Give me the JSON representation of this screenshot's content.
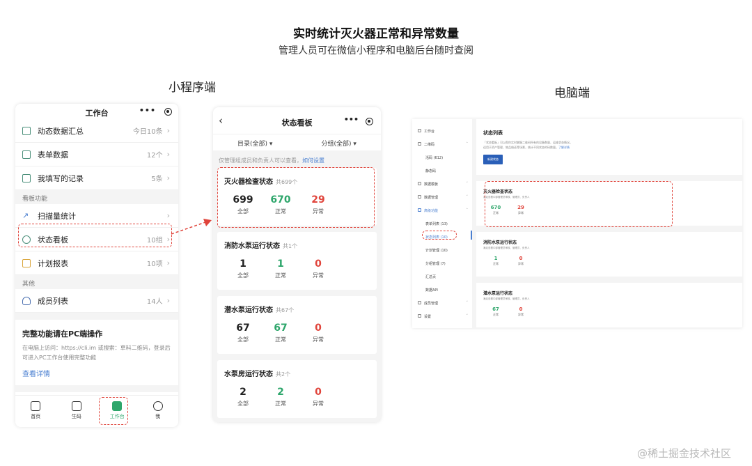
{
  "header": {
    "title": "实时统计灭火器正常和异常数量",
    "subtitle": "管理人员可在微信小程序和电脑后台随时查阅"
  },
  "labels": {
    "mini": "小程序端",
    "pc": "电脑端"
  },
  "watermark": "@稀土掘金技术社区",
  "phone1": {
    "title": "工作台",
    "menu_dots": "•••",
    "rows_top": [
      {
        "label": "动态数据汇总",
        "value": "今日10条",
        "icon": "chart-icon"
      },
      {
        "label": "表单数据",
        "value": "12个",
        "icon": "form-icon"
      },
      {
        "label": "我填写的记录",
        "value": "5条",
        "icon": "record-icon"
      }
    ],
    "section_board": "看板功能",
    "rows_board": [
      {
        "label": "扫描量统计",
        "value": "",
        "icon": "trend-icon"
      },
      {
        "label": "状态看板",
        "value": "10组",
        "icon": "status-icon"
      },
      {
        "label": "计划报表",
        "value": "10项",
        "icon": "plan-icon"
      }
    ],
    "section_other": "其他",
    "rows_other": [
      {
        "label": "成员列表",
        "value": "14人",
        "icon": "member-icon"
      }
    ],
    "promo": {
      "title": "完整功能请在PC端操作",
      "text": "在电脑上访问：https://cli.im 或搜索：草料二维码，登录后可进入PC工作台使用完整功能",
      "link": "查看详情"
    },
    "tabs": [
      {
        "label": "首页",
        "icon": "home-icon"
      },
      {
        "label": "生码",
        "icon": "grid-icon"
      },
      {
        "label": "工作台",
        "icon": "cube-icon"
      },
      {
        "label": "我",
        "icon": "user-icon"
      }
    ],
    "chevron": "›"
  },
  "phone2": {
    "back": "‹",
    "title": "状态看板",
    "menu_dots": "•••",
    "filter_dir": "目录(全部) ▾",
    "filter_group": "分组(全部) ▾",
    "notice": "仅管理组成员和负责人可以查看，",
    "notice_link": "如何设置",
    "cards": [
      {
        "title": "灭火器检查状态",
        "count": "共699个",
        "total": "699",
        "normal": "670",
        "abnormal": "29"
      },
      {
        "title": "消防水泵运行状态",
        "count": "共1个",
        "total": "1",
        "normal": "1",
        "abnormal": "0"
      },
      {
        "title": "潜水泵运行状态",
        "count": "共67个",
        "total": "67",
        "normal": "67",
        "abnormal": "0"
      },
      {
        "title": "水泵房运行状态",
        "count": "共2个",
        "total": "2",
        "normal": "2",
        "abnormal": "0"
      }
    ],
    "stat_labels": {
      "total": "全部",
      "normal": "正常",
      "abnormal": "异常"
    }
  },
  "desktop": {
    "sidebar": [
      {
        "label": "工作台",
        "sub": false,
        "arrow": ""
      },
      {
        "label": "二维码",
        "sub": false,
        "arrow": "˄"
      },
      {
        "label": "活码 (612)",
        "sub": true,
        "arrow": ""
      },
      {
        "label": "静态码",
        "sub": true,
        "arrow": ""
      },
      {
        "label": "数据模板",
        "sub": false,
        "arrow": "˅"
      },
      {
        "label": "数据管理",
        "sub": false,
        "arrow": "˅"
      },
      {
        "label": "高级功能",
        "sub": false,
        "arrow": "˄"
      },
      {
        "label": "表单列表 (13)",
        "sub": true,
        "arrow": ""
      },
      {
        "label": "状态列表 (10)",
        "sub": true,
        "arrow": "",
        "active": true
      },
      {
        "label": "计划管理 (10)",
        "sub": true,
        "arrow": ""
      },
      {
        "label": "分组管理 (7)",
        "sub": true,
        "arrow": ""
      },
      {
        "label": "汇总页",
        "sub": true,
        "arrow": ""
      },
      {
        "label": "数据API",
        "sub": true,
        "arrow": ""
      },
      {
        "label": "成员管理",
        "sub": false,
        "arrow": "˅"
      },
      {
        "label": "设置",
        "sub": false,
        "arrow": "˅"
      }
    ],
    "top": {
      "title": "状态列表",
      "desc1": "「状态看板」可以帮你实时掌握二维码所有的设备数量、运维状态情况。",
      "desc2": "适用于资产管理、物品借还等场景，统计不同状态的码数量。",
      "desc_link": "了解详情",
      "button": "新建状态"
    },
    "cards": [
      {
        "title": "灭火器检查状态",
        "desc": "满足查看中部管理员审核、管理员、负责人",
        "normal": "670",
        "abnormal": "29"
      },
      {
        "title": "消防水泵运行状态",
        "desc": "满足查看中部管理员审核、管理员、负责人",
        "normal": "1",
        "abnormal": "0"
      },
      {
        "title": "潜水泵运行状态",
        "desc": "满足查看中部管理员审核、管理员、负责人",
        "normal": "67",
        "abnormal": "0"
      }
    ],
    "stat_labels": {
      "normal": "正常",
      "abnormal": "异常"
    }
  }
}
